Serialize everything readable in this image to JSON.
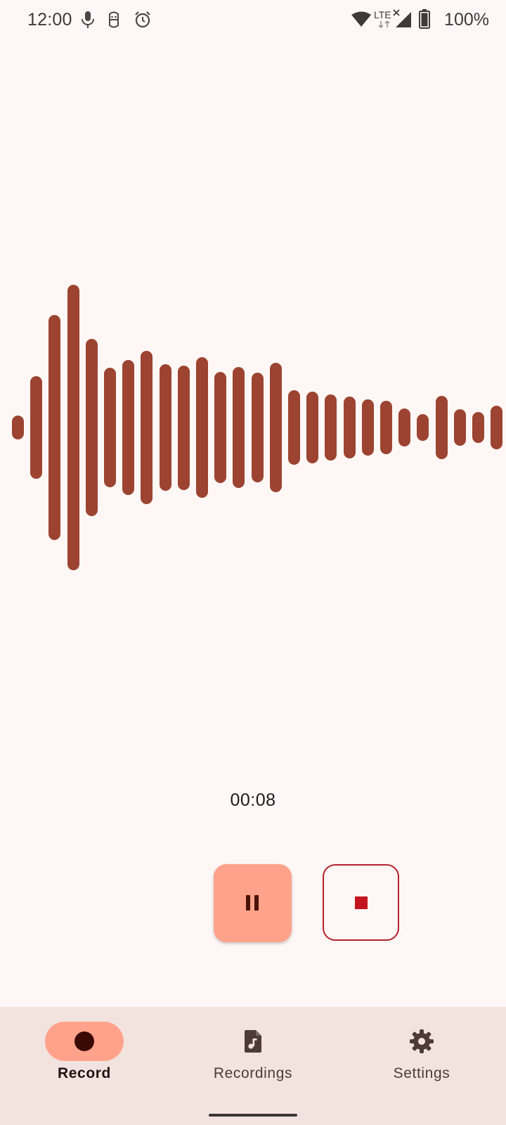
{
  "status_bar": {
    "time": "12:00",
    "network_label": "LTE",
    "battery_percent": "100%",
    "icons": [
      "mic-icon",
      "assistant-icon",
      "alarm-icon",
      "wifi-icon",
      "lte-icon",
      "signal-icon",
      "battery-icon"
    ]
  },
  "waveform": {
    "bar_color": "#9c4431",
    "amplitudes": [
      0.14,
      0.62,
      1.36,
      1.72,
      1.07,
      0.72,
      0.81,
      0.92,
      0.76,
      0.75,
      0.85,
      0.67,
      0.73,
      0.66,
      0.78,
      0.45,
      0.43,
      0.4,
      0.37,
      0.34,
      0.32,
      0.23,
      0.16,
      0.38,
      0.22,
      0.19,
      0.26
    ]
  },
  "recorder": {
    "elapsed_time": "00:08",
    "pause_icon": "pause-icon",
    "stop_icon": "stop-icon"
  },
  "bottom_nav": {
    "active": "Record",
    "items": [
      {
        "label": "Record",
        "icon": "record-dot-icon"
      },
      {
        "label": "Recordings",
        "icon": "audio-file-icon"
      },
      {
        "label": "Settings",
        "icon": "gear-icon"
      }
    ]
  },
  "colors": {
    "background": "#fff7f5",
    "accent": "#ffa28c",
    "waveform": "#9c4431",
    "stop": "#c4141d",
    "nav_background": "#f3e3de"
  }
}
